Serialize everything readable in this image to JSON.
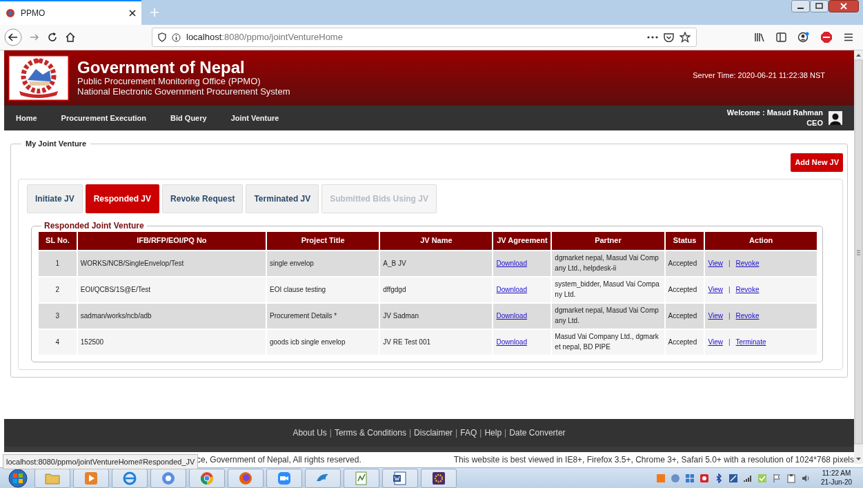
{
  "browser": {
    "tab_title": "PPMO",
    "url": {
      "host": "localhost",
      "rest": ":8080/ppmo/jointVentureHome"
    }
  },
  "header": {
    "title": "Government of Nepal",
    "subtitle_lines": [
      "Public Procurement Monitoring Office (PPMO)",
      "National Electronic Government Procurement System"
    ],
    "server_time": "Server Time: 2020-06-21 11:22:38 NST"
  },
  "menu": [
    {
      "label": "Home"
    },
    {
      "label": "Procurement Execution"
    },
    {
      "label": "Bid Query"
    },
    {
      "label": "Joint Venture"
    }
  ],
  "user": {
    "welcome": "Welcome : Masud Rahman",
    "role": "CEO"
  },
  "panel": {
    "legend": "My Joint Venture",
    "add_button": "Add New JV"
  },
  "tabs": [
    {
      "label": "Initiate JV",
      "selected": false,
      "disabled": false
    },
    {
      "label": "Responded JV",
      "selected": true,
      "disabled": false
    },
    {
      "label": "Revoke Request",
      "selected": false,
      "disabled": false
    },
    {
      "label": "Terminated JV",
      "selected": false,
      "disabled": false
    },
    {
      "label": "Submitted Bids Using JV",
      "selected": false,
      "disabled": true
    }
  ],
  "table": {
    "legend": "Responded Joint Venture",
    "columns": [
      "SL No.",
      "IFB/RFP/EOI/PQ No",
      "Project Title",
      "JV Name",
      "JV Agreement",
      "Partner",
      "Status",
      "Action"
    ],
    "rows": [
      {
        "sl": "1",
        "ifb": "WORKS/NCB/SingleEnvelop/Test",
        "title": "single envelop",
        "jv_name": "A_B JV",
        "agreement": "Download",
        "partner": "dgmarket nepal, Masud Vai Company Ltd., helpdesk-ii",
        "status": "Accepted",
        "actions": [
          {
            "kind": "link",
            "text": "View"
          },
          {
            "kind": "sep",
            "text": "|"
          },
          {
            "kind": "link",
            "text": "Revoke"
          }
        ]
      },
      {
        "sl": "2",
        "ifb": "EOI/QCBS/1S@E/Test",
        "title": "EOI clause testing",
        "jv_name": "dffgdgd",
        "agreement": "Download",
        "partner": "system_bidder, Masud Vai Company Ltd.",
        "status": "Accepted",
        "actions": [
          {
            "kind": "link",
            "text": "View"
          },
          {
            "kind": "sep",
            "text": "|"
          },
          {
            "kind": "link",
            "text": "Revoke"
          }
        ]
      },
      {
        "sl": "3",
        "ifb": "sadman/works/ncb/adb",
        "title": "Procurement Details *",
        "jv_name": "JV Sadman",
        "agreement": "Download",
        "partner": "dgmarket nepal, Masud Vai Company Ltd.",
        "status": "Accepted",
        "actions": [
          {
            "kind": "link",
            "text": "View"
          },
          {
            "kind": "sep",
            "text": "|"
          },
          {
            "kind": "link",
            "text": "Revoke"
          }
        ]
      },
      {
        "sl": "4",
        "ifb": "152500",
        "title": "goods icb single envelop",
        "jv_name": "JV RE Test 001",
        "agreement": "Download",
        "partner": "Masud Vai Company Ltd., dgmarket nepal, BD PIPE",
        "status": "Accepted",
        "actions": [
          {
            "kind": "link",
            "text": "View"
          },
          {
            "kind": "sep",
            "text": "|"
          },
          {
            "kind": "link",
            "text": "Terminate"
          }
        ]
      }
    ]
  },
  "footer": {
    "items": [
      {
        "kind": "link",
        "text": "About Us"
      },
      {
        "kind": "sep",
        "text": "|"
      },
      {
        "kind": "link",
        "text": "Terms & Conditions"
      },
      {
        "kind": "sep",
        "text": "|"
      },
      {
        "kind": "link",
        "text": "Disclaimer"
      },
      {
        "kind": "sep",
        "text": "|"
      },
      {
        "kind": "link",
        "text": "FAQ"
      },
      {
        "kind": "sep",
        "text": "|"
      },
      {
        "kind": "link",
        "text": "Help"
      },
      {
        "kind": "sep",
        "text": "|"
      },
      {
        "kind": "link",
        "text": "Date Converter"
      }
    ],
    "copyright": "ce, Government of Nepal, All rights reserved.",
    "browser_note": "This website is best viewed in IE8+, Firefox 3.5+, Chrome 3+, Safari 5.0+ with a resolution of 1024*768 pixels"
  },
  "status_url": "localhost:8080/ppmo/jointVentureHome#Responded_JV",
  "clock": {
    "time": "11:22 AM",
    "date": "21-Jun-20"
  }
}
